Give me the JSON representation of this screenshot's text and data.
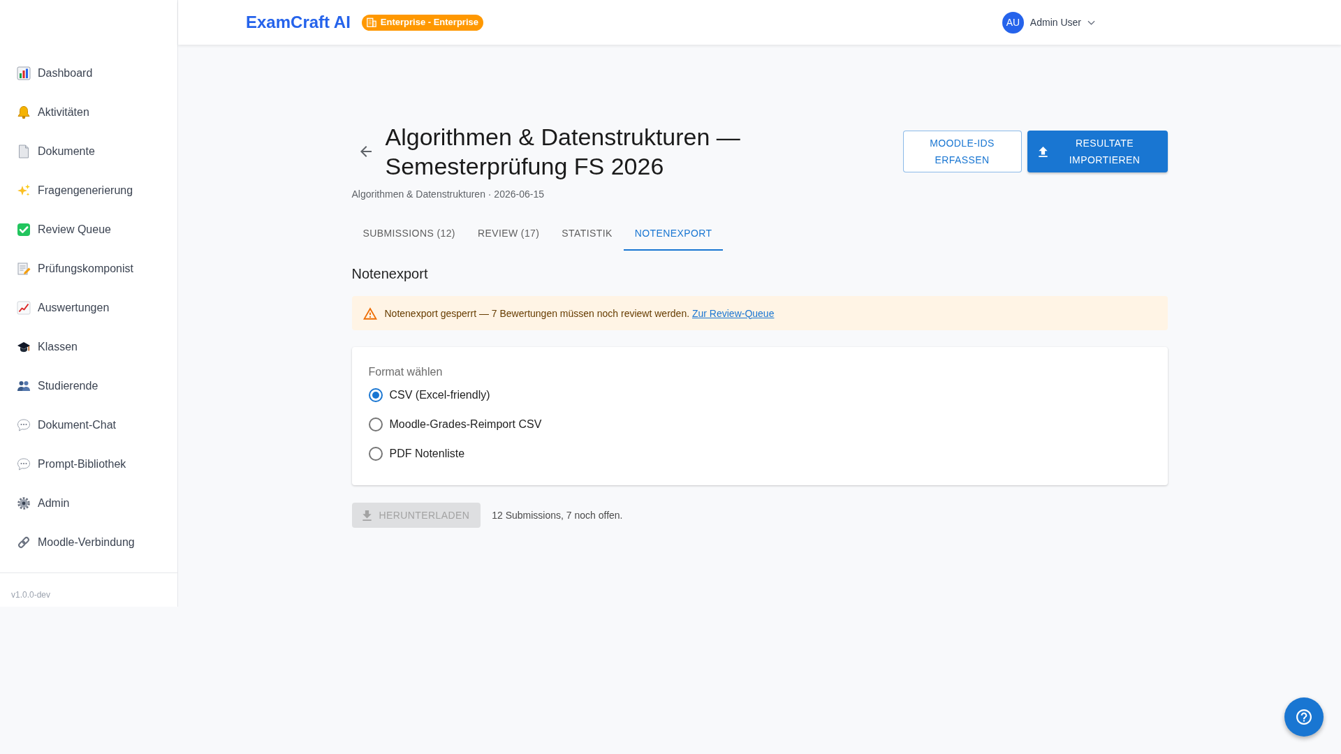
{
  "sidebar": {
    "items": [
      {
        "label": "Dashboard",
        "selected": false
      },
      {
        "label": "Aktivitäten",
        "selected": false
      },
      {
        "label": "Dokumente",
        "selected": false
      },
      {
        "label": "Fragengenerierung",
        "selected": false
      },
      {
        "label": "Review Queue",
        "selected": false
      },
      {
        "label": "Prüfungskomponist",
        "selected": false
      },
      {
        "label": "Auswertungen",
        "selected": false
      },
      {
        "label": "Klassen",
        "selected": false
      },
      {
        "label": "Studierende",
        "selected": false
      },
      {
        "label": "Dokument-Chat",
        "selected": false
      },
      {
        "label": "Prompt-Bibliothek",
        "selected": false
      },
      {
        "label": "Admin",
        "selected": false
      },
      {
        "label": "Moodle-Verbindung",
        "selected": false
      }
    ],
    "version": "v1.0.0-dev"
  },
  "header": {
    "logo": "ExamCraft AI",
    "plan_badge": "Enterprise - Enterprise",
    "user": {
      "initials": "AU",
      "name": "Admin User"
    }
  },
  "page": {
    "title": "Algorithmen & Datenstrukturen — Semesterprüfung FS 2026",
    "subtitle": "Algorithmen & Datenstrukturen · 2026-06-15",
    "actions": [
      {
        "label": "MOODLE-IDS ERFASSEN",
        "kind": "outlined"
      },
      {
        "label": "RESULTATE IMPORTIEREN",
        "kind": "contained"
      }
    ]
  },
  "tabs": [
    {
      "label": "SUBMISSIONS (12)",
      "selected": false
    },
    {
      "label": "REVIEW (17)",
      "selected": false
    },
    {
      "label": "STATISTIK",
      "selected": false
    },
    {
      "label": "NOTENEXPORT",
      "selected": true
    }
  ],
  "section": {
    "heading": "Notenexport",
    "alert": {
      "message": "Notenexport gesperrt — 7 Bewertungen müssen noch reviewt werden.",
      "link": "Zur Review-Queue"
    },
    "format": {
      "label": "Format wählen",
      "options": [
        {
          "label": "CSV (Excel-friendly)",
          "selected": true
        },
        {
          "label": "Moodle-Grades-Reimport CSV",
          "selected": false
        },
        {
          "label": "PDF Notenliste",
          "selected": false
        }
      ]
    },
    "download": {
      "label": "HERUNTERLADEN",
      "disabled": true
    },
    "summary": "12 Submissions, 7 noch offen."
  }
}
